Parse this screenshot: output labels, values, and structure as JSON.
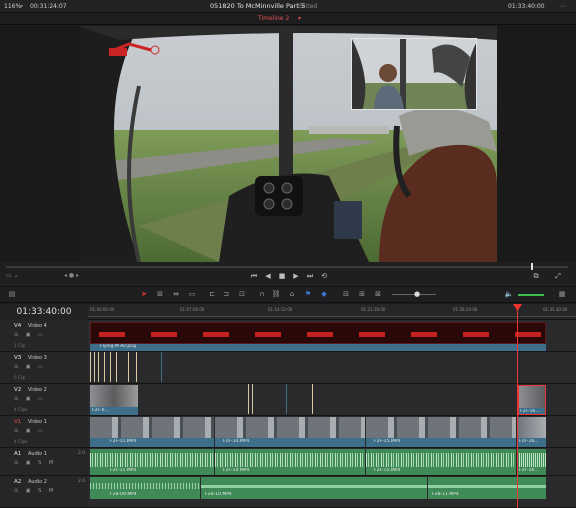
{
  "topbar": {
    "zoom": "116%",
    "timecode_left": "00:31:24:07",
    "project_title": "051820 To McMinnville Part 5",
    "edited_label": "Edited",
    "timecode_right": "01:33:40:00"
  },
  "title_bar": {
    "timeline_name": "Timeline 2"
  },
  "timeline": {
    "current_tc": "01:33:40:00",
    "ruler_ticks": [
      "01:00:00:00",
      "01:07:06:00",
      "01:14:12:00",
      "01:21:18:00",
      "01:28:24:00",
      "01:35:30:00"
    ]
  },
  "tracks": {
    "v4": {
      "id": "V4",
      "name": "Video 4",
      "count": "1 Clip",
      "clip": "Flying M Air.png"
    },
    "v3": {
      "id": "V3",
      "name": "Video 3",
      "count": "0 Clip"
    },
    "v2": {
      "id": "V2",
      "name": "Video 2",
      "count": "4 Clips",
      "clip": "F2F-0...",
      "clip2": "F2F-16..."
    },
    "v1": {
      "id": "V1",
      "name": "Video 1",
      "count": "4 Clips",
      "clips": [
        "F2F-11.MP4",
        "F2F-14.MP4",
        "F2F-15.MP4",
        "F2F-16..."
      ]
    },
    "a1": {
      "id": "A1",
      "name": "Audio 1",
      "level": "2.0",
      "clips": [
        "F2F-11.MP4",
        "F2F-14.MP4",
        "F2F-15.MP4",
        "F2F-16..."
      ]
    },
    "a2": {
      "id": "A2",
      "name": "Audio 2",
      "level": "2.0",
      "clips": [
        "F2B-09.MP4",
        "F2B-10.MP4",
        "F2B-11.MP4"
      ]
    }
  },
  "colors": {
    "accent_red": "#e33",
    "video_clip": "#3e6f8a",
    "audio_clip": "#3f8a57",
    "graphic_clip": "#7a1515"
  }
}
